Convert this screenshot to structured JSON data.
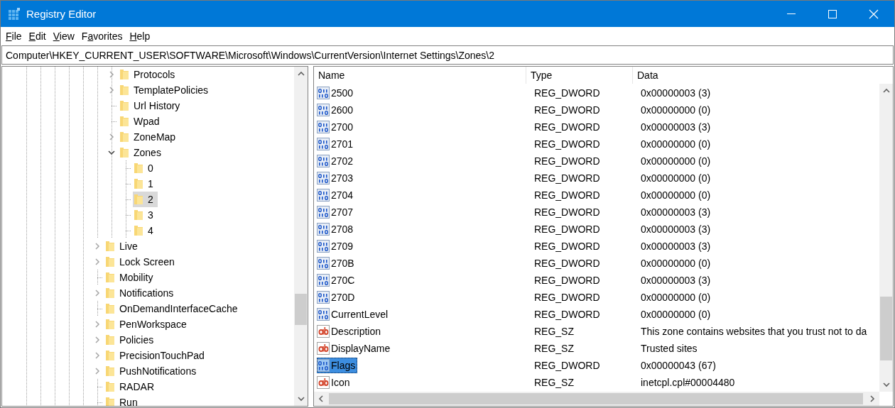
{
  "window": {
    "title": "Registry Editor"
  },
  "menu": [
    {
      "label": "File"
    },
    {
      "label": "Edit"
    },
    {
      "label": "View"
    },
    {
      "label": "Favorites"
    },
    {
      "label": "Help"
    }
  ],
  "address_bar": {
    "value": "Computer\\HKEY_CURRENT_USER\\SOFTWARE\\Microsoft\\Windows\\CurrentVersion\\Internet Settings\\Zones\\2"
  },
  "tree": {
    "items": [
      {
        "children": [
          {
            "label": "Protocols",
            "kind": "branch",
            "expanded": false,
            "selected": false
          },
          {
            "label": "TemplatePolicies",
            "kind": "branch",
            "expanded": false,
            "selected": false
          },
          {
            "label": "Url History",
            "kind": "leaf",
            "selected": false
          },
          {
            "label": "Wpad",
            "kind": "leaf",
            "selected": false
          },
          {
            "label": "ZoneMap",
            "kind": "branch",
            "expanded": false,
            "selected": false
          },
          {
            "label": "Zones",
            "kind": "branch",
            "expanded": true,
            "selected": false,
            "children": [
              {
                "label": "0",
                "kind": "leaf",
                "selected": false
              },
              {
                "label": "1",
                "kind": "leaf",
                "selected": false
              },
              {
                "label": "2",
                "kind": "leaf",
                "selected": true
              },
              {
                "label": "3",
                "kind": "leaf",
                "selected": false
              },
              {
                "label": "4",
                "kind": "leaf",
                "selected": false
              }
            ]
          }
        ]
      },
      {
        "label": "Live",
        "kind": "branch",
        "expanded": false,
        "selected": false
      },
      {
        "label": "Lock Screen",
        "kind": "branch",
        "expanded": false,
        "selected": false
      },
      {
        "label": "Mobility",
        "kind": "leaf",
        "selected": false
      },
      {
        "label": "Notifications",
        "kind": "branch",
        "expanded": false,
        "selected": false
      },
      {
        "label": "OnDemandInterfaceCache",
        "kind": "leaf",
        "selected": false
      },
      {
        "label": "PenWorkspace",
        "kind": "branch",
        "expanded": false,
        "selected": false
      },
      {
        "label": "Policies",
        "kind": "branch",
        "expanded": false,
        "selected": false
      },
      {
        "label": "PrecisionTouchPad",
        "kind": "branch",
        "expanded": false,
        "selected": false
      },
      {
        "label": "PushNotifications",
        "kind": "branch",
        "expanded": false,
        "selected": false
      },
      {
        "label": "RADAR",
        "kind": "leaf",
        "selected": false
      },
      {
        "label": "Run",
        "kind": "leaf",
        "selected": false
      }
    ]
  },
  "values": {
    "columns": [
      "Name",
      "Type",
      "Data"
    ],
    "rows": [
      {
        "name": "2500",
        "type": "REG_DWORD",
        "data": "0x00000003 (3)",
        "kind": "dword",
        "selected": false
      },
      {
        "name": "2600",
        "type": "REG_DWORD",
        "data": "0x00000000 (0)",
        "kind": "dword",
        "selected": false
      },
      {
        "name": "2700",
        "type": "REG_DWORD",
        "data": "0x00000003 (3)",
        "kind": "dword",
        "selected": false
      },
      {
        "name": "2701",
        "type": "REG_DWORD",
        "data": "0x00000000 (0)",
        "kind": "dword",
        "selected": false
      },
      {
        "name": "2702",
        "type": "REG_DWORD",
        "data": "0x00000000 (0)",
        "kind": "dword",
        "selected": false
      },
      {
        "name": "2703",
        "type": "REG_DWORD",
        "data": "0x00000000 (0)",
        "kind": "dword",
        "selected": false
      },
      {
        "name": "2704",
        "type": "REG_DWORD",
        "data": "0x00000000 (0)",
        "kind": "dword",
        "selected": false
      },
      {
        "name": "2707",
        "type": "REG_DWORD",
        "data": "0x00000003 (3)",
        "kind": "dword",
        "selected": false
      },
      {
        "name": "2708",
        "type": "REG_DWORD",
        "data": "0x00000003 (3)",
        "kind": "dword",
        "selected": false
      },
      {
        "name": "2709",
        "type": "REG_DWORD",
        "data": "0x00000003 (3)",
        "kind": "dword",
        "selected": false
      },
      {
        "name": "270B",
        "type": "REG_DWORD",
        "data": "0x00000000 (0)",
        "kind": "dword",
        "selected": false
      },
      {
        "name": "270C",
        "type": "REG_DWORD",
        "data": "0x00000003 (3)",
        "kind": "dword",
        "selected": false
      },
      {
        "name": "270D",
        "type": "REG_DWORD",
        "data": "0x00000000 (0)",
        "kind": "dword",
        "selected": false
      },
      {
        "name": "CurrentLevel",
        "type": "REG_DWORD",
        "data": "0x00000000 (0)",
        "kind": "dword",
        "selected": false
      },
      {
        "name": "Description",
        "type": "REG_SZ",
        "data": "This zone contains websites that you trust not to da",
        "kind": "string",
        "selected": false
      },
      {
        "name": "DisplayName",
        "type": "REG_SZ",
        "data": "Trusted sites",
        "kind": "string",
        "selected": false
      },
      {
        "name": "Flags",
        "type": "REG_DWORD",
        "data": "0x00000043 (67)",
        "kind": "dword",
        "selected": true
      },
      {
        "name": "Icon",
        "type": "REG_SZ",
        "data": "inetcpl.cpl#00004480",
        "kind": "string",
        "selected": false
      }
    ]
  }
}
